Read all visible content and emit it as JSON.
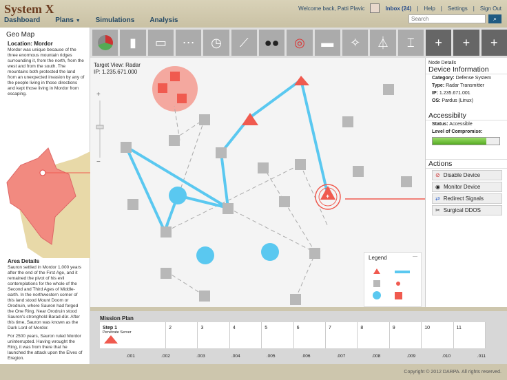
{
  "app": {
    "name": "System X"
  },
  "nav": [
    "Dashboard",
    "Plans",
    "Simulations",
    "Analysis"
  ],
  "nav_caret": "▼",
  "user": {
    "welcome": "Welcome back, Patti Plavic",
    "inbox": "Inbox (24)",
    "help": "Help",
    "settings": "Settings",
    "signout": "Sign Out",
    "separator": "|"
  },
  "search": {
    "placeholder": "Search",
    "button_icon": "search-icon"
  },
  "left": {
    "title": "Geo Map",
    "location": "Location: Mordor",
    "desc": "Mordor was unique because of the three enormous mountain ridges surrounding it, from the north, from the west and from the south. The mountains both protected the land from an unexpected invasion by any of the people living in those directions and kept those living in Mordor from escaping.",
    "area_title": "Area Details",
    "area_p1": "Sauron settled in Mordor 1,000 years after the end of the First Age, and it remained the pivot of his evil contemplations for the whole of the Second and Third Ages of Middle-earth. In the northwestern corner of this land stood Mount Doom or Orodruin, where Sauron had forged the One Ring. Near Orodruin stood Sauron's stronghold Barad-dûr. After this time, Sauron was known as the Dark Lord of Mordor.",
    "area_p2": "For 2500 years, Sauron ruled Mordor uninterrupted. Having wrought the Ring, it was from there that he launched the attack upon the Elves of Eregion."
  },
  "toolbar": [
    "pie-chart-icon",
    "bar-chart-icon",
    "screen-icon",
    "network-icon",
    "clock-icon",
    "line-chart-icon",
    "binoculars-icon",
    "target-icon",
    "router-icon",
    "satellite-icon",
    "antenna-icon",
    "modem-icon",
    "plus-icon",
    "plus-icon",
    "plus-icon"
  ],
  "toolbar_plus": "+",
  "map": {
    "target": "Target View: Radar",
    "ip": "IP: 1.235.671.000",
    "legend": "Legend",
    "zoom_plus": "+",
    "zoom_minus": "−",
    "legend_close": "—",
    "node_plus": "+"
  },
  "right": {
    "small": "Node Details",
    "title": "Device Information",
    "category": "Defense System",
    "type": "Radar Transmitter",
    "ip": "1.235.671.001",
    "os": "Pardus (Linux)",
    "category_label": "Category:",
    "type_label": "Type:",
    "ip_label": "IP:",
    "os_label": "OS:",
    "access_title": "Accessibilty",
    "status": "Accessible",
    "status_label": "Status:",
    "level": "Level of Compromise:",
    "actions_title": "Actions",
    "actions": [
      "Disable Device",
      "Monitor Device",
      "Redirect Signals",
      "Surgical DDOS"
    ]
  },
  "mission": {
    "title": "Mission Plan",
    "step1": "Step 1",
    "step1_sub": "Penetrate Server",
    "steps": [
      "2",
      "3",
      "4",
      "5",
      "6",
      "7",
      "8",
      "9",
      "10",
      "11"
    ],
    "ticks": [
      ".001",
      ".002",
      ".003",
      ".004",
      ".005",
      ".006",
      ".007",
      ".008",
      ".009",
      ".010",
      ".011"
    ]
  },
  "footer": "Copyright © 2012 DARPA. All rights reserved.",
  "colors": {
    "accent": "#f05a4f",
    "link": "#5ac8f0",
    "node": "#b8b8b8"
  }
}
